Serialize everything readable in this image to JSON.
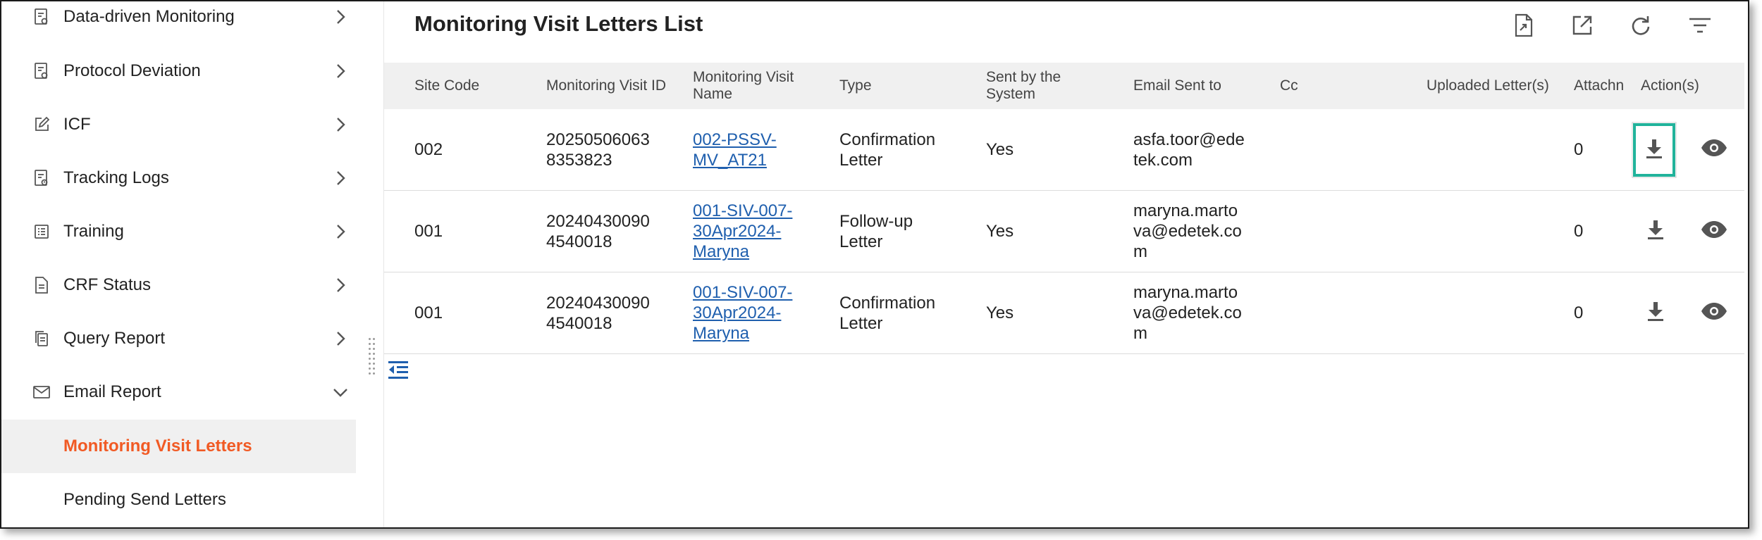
{
  "sidebar": {
    "items": [
      {
        "label": "Data-driven Monitoring"
      },
      {
        "label": "Protocol Deviation"
      },
      {
        "label": "ICF"
      },
      {
        "label": "Tracking Logs"
      },
      {
        "label": "Training"
      },
      {
        "label": "CRF Status"
      },
      {
        "label": "Query Report"
      },
      {
        "label": "Email Report"
      }
    ],
    "sub_items": [
      {
        "label": "Monitoring Visit Letters"
      },
      {
        "label": "Pending Send Letters"
      }
    ]
  },
  "main": {
    "title": "Monitoring Visit Letters List",
    "table": {
      "headers": {
        "site_code": "Site Code",
        "visit_id": "Monitoring Visit ID",
        "visit_name": "Monitoring Visit Name",
        "type": "Type",
        "sent_by_system": "Sent by the System",
        "email_sent_to": "Email Sent to",
        "cc": "Cc",
        "uploaded": "Uploaded Letter(s)",
        "attachments": "Attachn",
        "actions": "Action(s)"
      },
      "rows": [
        {
          "site_code": "002",
          "visit_id": "20250506063\n8353823",
          "visit_name": "002-PSSV-\nMV_AT21",
          "type": "Confirmation\nLetter",
          "sent": "Yes",
          "email": "asfa.toor@ede\ntek.com",
          "cc": "",
          "uploaded": "",
          "attachments": "0"
        },
        {
          "site_code": "001",
          "visit_id": "20240430090\n4540018",
          "visit_name": "001-SIV-007-\n30Apr2024-\nMaryna",
          "type": "Follow-up\nLetter",
          "sent": "Yes",
          "email": "maryna.marto\nva@edetek.co\nm",
          "cc": "",
          "uploaded": "",
          "attachments": "0"
        },
        {
          "site_code": "001",
          "visit_id": "20240430090\n4540018",
          "visit_name": "001-SIV-007-\n30Apr2024-\nMaryna",
          "type": "Confirmation\nLetter",
          "sent": "Yes",
          "email": "maryna.marto\nva@edetek.co\nm",
          "cc": "",
          "uploaded": "",
          "attachments": "0"
        }
      ]
    }
  },
  "colors": {
    "accent": "#f15a24",
    "link": "#1f5fae",
    "highlight": "#21b39b",
    "header_bg": "#f0f0f0"
  },
  "icons": [
    "report-icon",
    "edit-icon",
    "log-icon",
    "list-icon",
    "doc-icon",
    "copy-icon",
    "mail-icon",
    "chevron-right-icon",
    "chevron-down-icon",
    "export-file-icon",
    "open-external-icon",
    "refresh-icon",
    "filter-icon",
    "download-icon",
    "view-icon",
    "collapse-icon"
  ]
}
